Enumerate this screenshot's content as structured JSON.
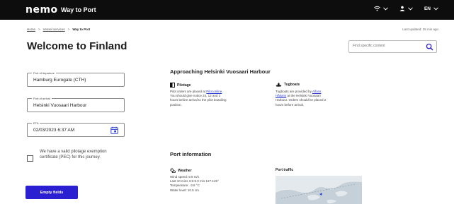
{
  "header": {
    "logo": "nemo",
    "title": "Way to Port",
    "language": "EN"
  },
  "breadcrumb": {
    "items": [
      "Home",
      "Vessel services",
      "Way to Port"
    ],
    "separator": ">"
  },
  "updated": "Last updated: 35 min ago",
  "page_title": "Welcome to Finland",
  "search": {
    "placeholder": "Find specific content"
  },
  "form": {
    "departure": {
      "label": "Port of departure",
      "value": "Hamburg Eurogate (CTH)"
    },
    "arrival": {
      "label": "Port of arrival",
      "value": "Helsinki Vuosaari Harbour"
    },
    "eta": {
      "label": "ETA",
      "value": "02/03/2023  6:37 AM"
    },
    "pec_label": "We have a valid pilotage exemption certificate (PEC) for this journey.",
    "empty_button": "Empty fields"
  },
  "approach": {
    "heading": "Approaching Helsinki Vuosaari Harbour",
    "pilotage": {
      "title": "Pilotage",
      "text1": "Pilot orders are placed at",
      "link": "Pilot online",
      "text2": ". You should give notice 24, 12 and 3 hours before arrival to the pilot boarding position."
    },
    "tugboats": {
      "title": "Tugboats",
      "text1": "Tugboats are provided by",
      "link": "Alfons Håkans",
      "text2": " at the Helsinki Vuosaari Harbour. Orders should be placed 2 hours before arrival."
    }
  },
  "port_info": {
    "heading": "Port information",
    "weather": {
      "title": "Weather",
      "lines": [
        "Wind speed: 8.9 m/s",
        "Last 10 mins 3.8-9.0 m/s 127-145°",
        "Temperature: -3.8 °C",
        "Water level: 10.5 cm"
      ]
    },
    "traffic_title": "Port traffic"
  },
  "colors": {
    "topbar": "#0d0d0d",
    "primary": "#2b1fd2",
    "link": "#2b3fd2"
  },
  "icons": [
    "wifi-icon",
    "chevron-down-icon",
    "user-icon",
    "search-icon",
    "calendar-icon",
    "pilot-icon",
    "tugboat-icon",
    "weather-icon"
  ]
}
